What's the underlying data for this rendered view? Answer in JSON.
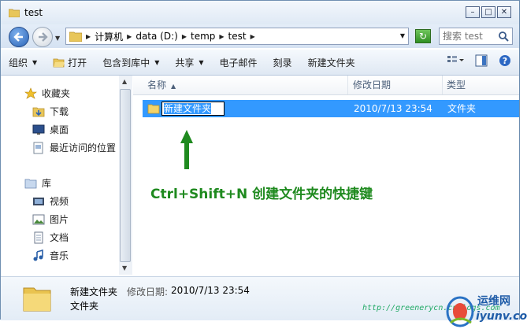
{
  "window": {
    "title": "test"
  },
  "address": {
    "path": [
      "计算机",
      "data (D:)",
      "temp",
      "test"
    ],
    "search_placeholder": "搜索 test"
  },
  "toolbar": {
    "organize": "组织",
    "open": "打开",
    "include_library": "包含到库中",
    "share": "共享",
    "email": "电子邮件",
    "burn": "刻录",
    "new_folder": "新建文件夹"
  },
  "sidebar": {
    "favorites": "收藏夹",
    "downloads": "下载",
    "desktop": "桌面",
    "recent": "最近访问的位置",
    "libraries": "库",
    "videos": "视频",
    "pictures": "图片",
    "documents": "文档",
    "music": "音乐"
  },
  "columns": {
    "name": "名称",
    "date": "修改日期",
    "type": "类型"
  },
  "row": {
    "name": "新建文件夹",
    "date": "2010/7/13 23:54",
    "type": "文件夹"
  },
  "caption": "Ctrl+Shift+N  创建文件夹的快捷键",
  "status": {
    "name": "新建文件夹",
    "date_label": "修改日期:",
    "date": "2010/7/13 23:54",
    "type": "文件夹"
  },
  "watermark": {
    "url": "http://greenerycn.cnblogs.com",
    "logo_cn": "运维网",
    "logo_en": "iyunv.com"
  },
  "colors": {
    "selection": "#3399ff",
    "caption": "#1f8a1f",
    "arrow": "#1f8a1f"
  }
}
